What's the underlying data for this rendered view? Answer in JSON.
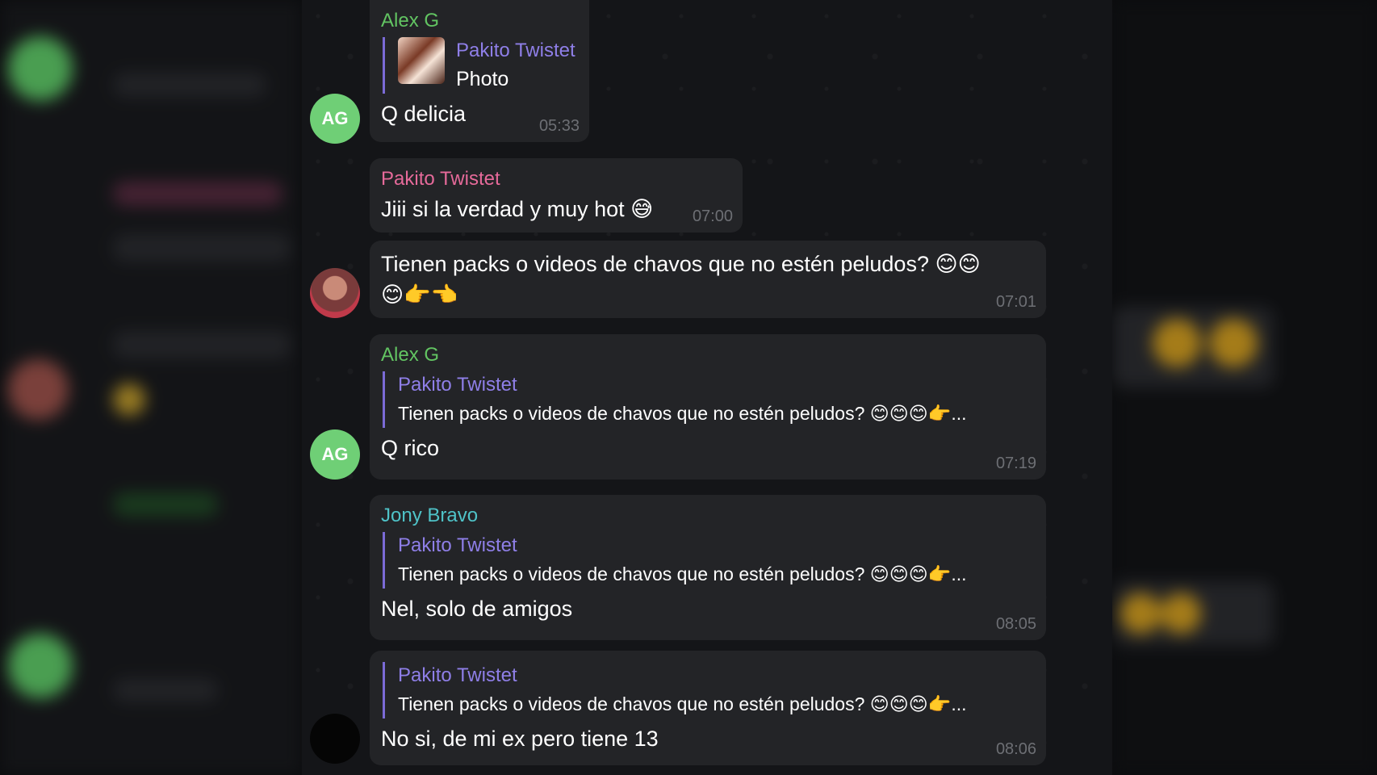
{
  "messages": [
    {
      "sender": "Alex G",
      "avatar": "AG",
      "reply": {
        "name": "Pakito Twistet",
        "text": "Photo"
      },
      "text": "Q delicia",
      "time": "05:33"
    },
    {
      "sender": "Pakito Twistet",
      "text": "Jiii si la verdad y muy hot 😅",
      "time": "07:00"
    },
    {
      "text_line1": "Tienen packs o videos de chavos que no estén peludos? 😊😊",
      "text_line2": "😊👉👈",
      "time": "07:01"
    },
    {
      "sender": "Alex G",
      "avatar": "AG",
      "reply": {
        "name": "Pakito Twistet",
        "text": "Tienen packs o videos de chavos que no estén peludos? 😊😊😊👉..."
      },
      "text": "Q rico",
      "time": "07:19"
    },
    {
      "sender": "Jony Bravo",
      "reply": {
        "name": "Pakito Twistet",
        "text": "Tienen packs o videos de chavos que no estén peludos? 😊😊😊👉..."
      },
      "text": "Nel, solo de amigos",
      "time": "08:05"
    },
    {
      "reply": {
        "name": "Pakito Twistet",
        "text": "Tienen packs o videos de chavos que no estén peludos? 😊😊😊👉..."
      },
      "text": "No si, de mi ex pero tiene 13",
      "time": "08:06"
    }
  ],
  "colors": {
    "alex": "#62c462",
    "pakito": "#e66a9a",
    "jony": "#4fc3c8",
    "reply_accent": "#7b6bd6",
    "bubble": "#232427"
  }
}
